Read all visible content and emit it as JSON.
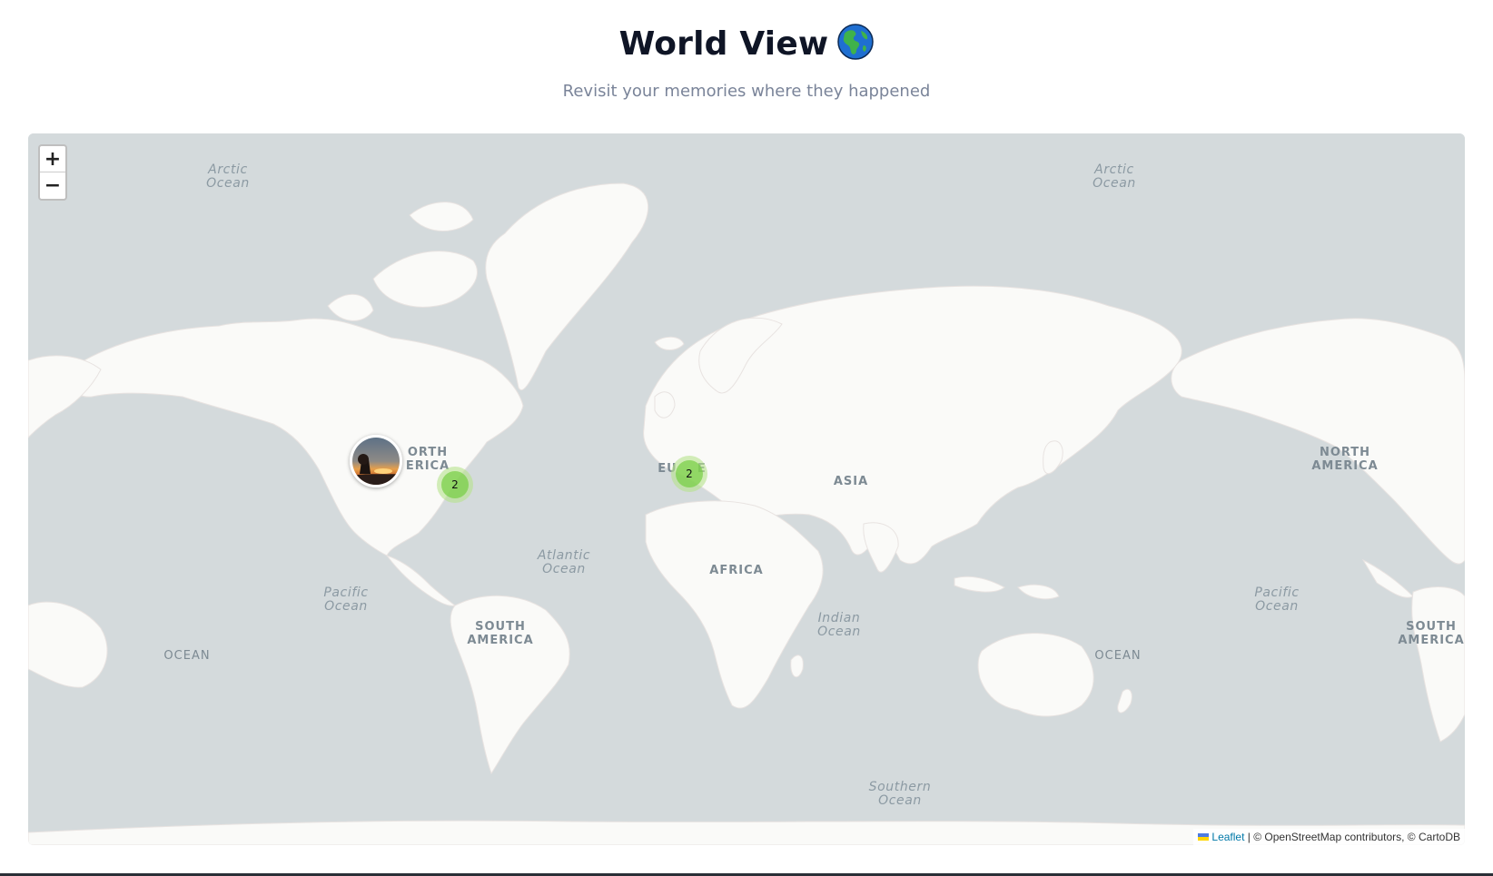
{
  "header": {
    "title": "World View",
    "title_icon": "globe-americas-icon",
    "subtitle": "Revisit your memories where they happened"
  },
  "map": {
    "zoom_in_label": "+",
    "zoom_out_label": "−",
    "labels": {
      "arctic_left": [
        "Arctic",
        "Ocean"
      ],
      "arctic_right": [
        "Arctic",
        "Ocean"
      ],
      "north_america_left": [
        "ORTH",
        "ERICA"
      ],
      "north_america_right": [
        "NORTH",
        "AMERICA"
      ],
      "europe": "EU    E",
      "asia": "ASIA",
      "africa": "AFRICA",
      "atlantic": [
        "Atlantic",
        "Ocean"
      ],
      "pacific_left": [
        "Pacific",
        "Ocean"
      ],
      "pacific_right": [
        "Pacific",
        "Ocean"
      ],
      "south_america_left": [
        "SOUTH",
        "AMERICA"
      ],
      "south_america_right": [
        "SOUTH",
        "AMERICA"
      ],
      "indian": [
        "Indian",
        "Ocean"
      ],
      "ocean_left": "OCEAN",
      "ocean_right": "OCEAN",
      "southern": [
        "Southern",
        "Ocean"
      ]
    },
    "markers": {
      "photo": {
        "type": "photo",
        "icon": "sunset-photo-thumbnail"
      },
      "clusters": [
        {
          "count": "2",
          "region": "eastern-north-america"
        },
        {
          "count": "2",
          "region": "southern-europe"
        }
      ]
    },
    "colors": {
      "water": "#d4dadc",
      "land": "#fafaf8",
      "cluster_outer": "#b5e28c",
      "cluster_inner": "#6ecc39",
      "link": "#0078a8"
    },
    "attribution": {
      "leaflet_link": "Leaflet",
      "rest": " | © OpenStreetMap contributors, © CartoDB"
    }
  }
}
